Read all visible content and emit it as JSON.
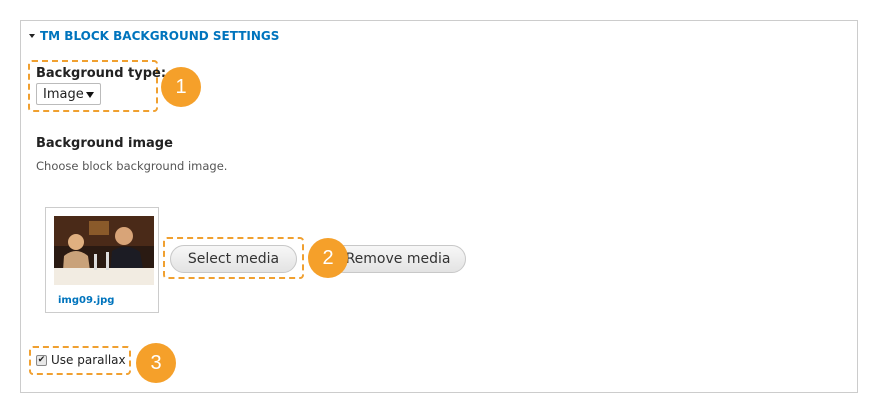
{
  "section": {
    "title": "TM BLOCK BACKGROUND SETTINGS"
  },
  "background_type": {
    "label": "Background type:",
    "selected": "Image"
  },
  "background_image": {
    "label": "Background image",
    "description": "Choose block background image.",
    "file_name": "img09.jpg",
    "select_label": "Select media",
    "remove_label": "Remove media"
  },
  "parallax": {
    "label": "Use parallax",
    "checked": true,
    "check_glyph": "✔"
  },
  "callouts": [
    "1",
    "2",
    "3"
  ],
  "colors": {
    "link": "#0074bd",
    "callout": "#f5a02a",
    "highlight_border": "#f0a030"
  }
}
